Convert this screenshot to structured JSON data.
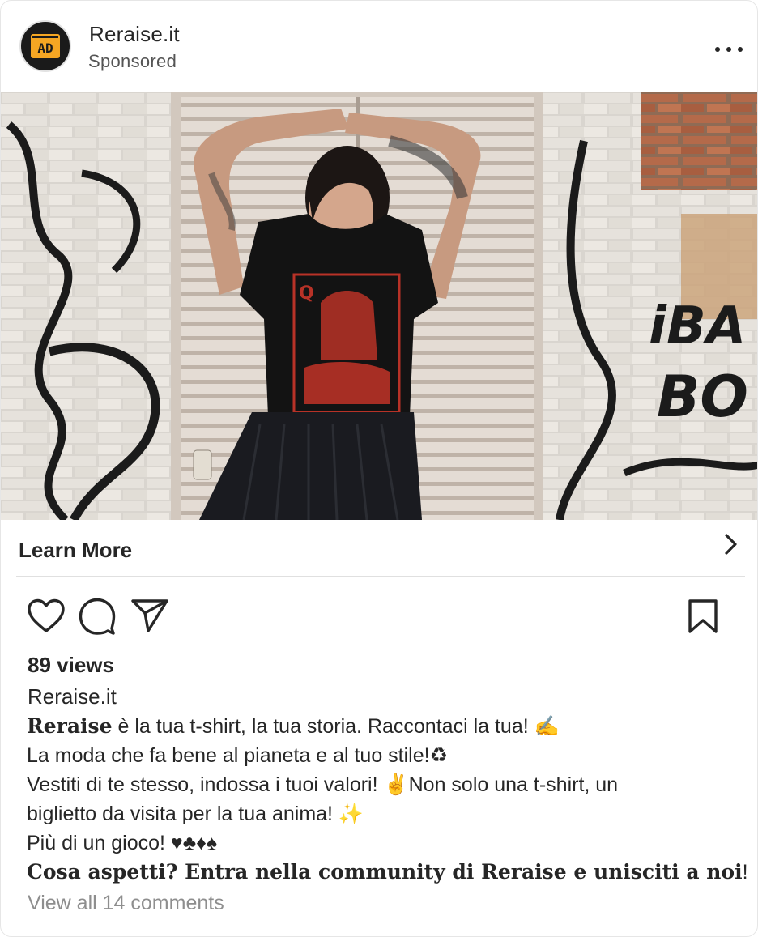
{
  "header": {
    "account_name": "Reraise.it",
    "subtitle": "Sponsored",
    "avatar_text": "AD",
    "avatar_colors": {
      "background": "#1a1a1a",
      "accent": "#f5a623"
    }
  },
  "cta": {
    "label": "Learn More",
    "icon": "chevron-right-icon"
  },
  "actions": {
    "like_icon": "heart-icon",
    "comment_icon": "comment-icon",
    "share_icon": "paper-plane-icon",
    "save_icon": "bookmark-icon"
  },
  "stats": {
    "views": "89 views"
  },
  "caption": {
    "username": "Reraise.it",
    "line1_bold": "Reraise",
    "line1_rest": " è la tua t-shirt, la tua storia. Raccontaci la tua! ✍",
    "line2": "La moda che fa bene al pianeta e al tuo stile!♻",
    "line3": "Vestiti di te stesso, indossa i tuoi valori! ✌Non solo una t-shirt, un",
    "line4": "biglietto da visita per la tua anima! ✨",
    "line5": "Più di un gioco! ♥♣♦♠",
    "line6_bold": "Cosa aspetti? Entra nella community di Reraise e unisciti a noi",
    "line6_end": "!"
  },
  "comments": {
    "label": "View all 14 comments"
  }
}
